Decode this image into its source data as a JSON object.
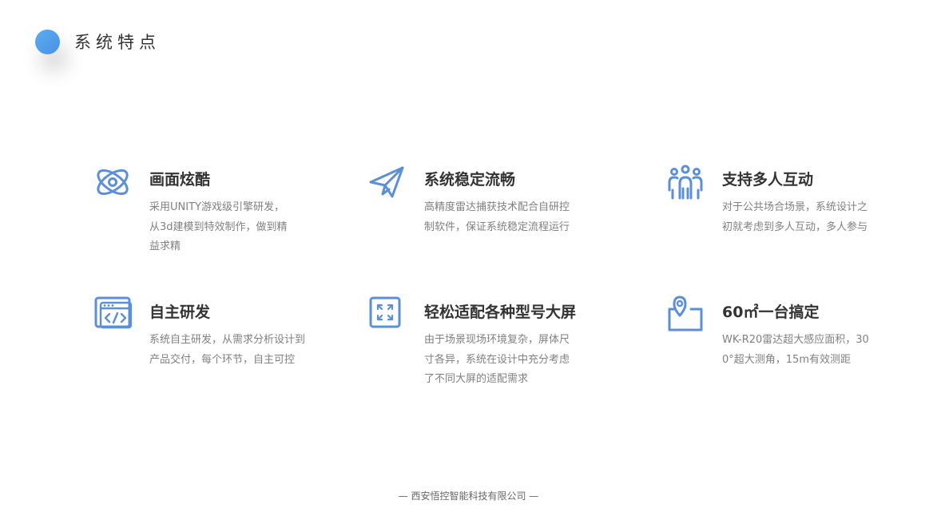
{
  "header": {
    "title": "系统特点"
  },
  "features": [
    {
      "title": "画面炫酷",
      "desc": "采用UNITY游戏级引擎研发，从3d建模到特效制作，做到精益求精",
      "icon": "atom-icon"
    },
    {
      "title": "系统稳定流畅",
      "desc": "高精度雷达捕获技术配合自研控制软件，保证系统稳定流程运行",
      "icon": "paper-plane-icon"
    },
    {
      "title": "支持多人互动",
      "desc": "对于公共场合场景，系统设计之初就考虑到多人互动，多人参与",
      "icon": "people-icon"
    },
    {
      "title": "自主研发",
      "desc": "系统自主研发，从需求分析设计到产品交付，每个环节，自主可控",
      "icon": "code-window-icon"
    },
    {
      "title": "轻松适配各种型号大屏",
      "desc": "由于场景现场环境复杂，屏体尺寸各异，系统在设计中充分考虑了不同大屏的适配需求",
      "icon": "expand-icon"
    },
    {
      "title": "60㎡一台搞定",
      "desc": "WK-R20雷达超大感应面积，300°超大测角，15m有效测距",
      "icon": "location-area-icon"
    }
  ],
  "footer": {
    "text": "— 西安悟控智能科技有限公司 —"
  },
  "colors": {
    "accent": "#5b8fd8",
    "dot_start": "#5aaef0",
    "dot_end": "#4a8fe6"
  }
}
